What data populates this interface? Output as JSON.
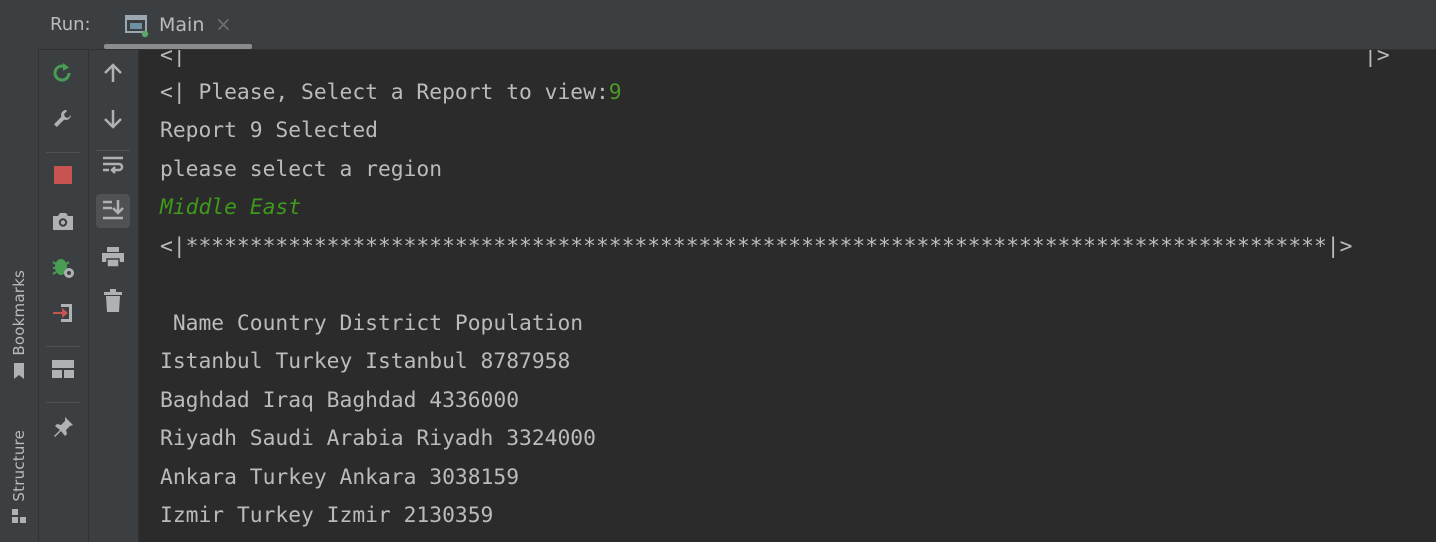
{
  "left_strip": {
    "bookmarks_label": "Bookmarks",
    "structure_label": "Structure"
  },
  "header": {
    "run_label": "Run:",
    "tab_label": "Main",
    "tab_close": "×"
  },
  "console": {
    "line0_left": "<|",
    "line0_right": "|>",
    "prompt_text": "<| Please, Select a Report to view:",
    "prompt_input": "9",
    "report_selected": "Report 9 Selected",
    "region_prompt": "please select a region",
    "region_input": "Middle East",
    "separator": "<|*****************************************************************************************|>",
    "table_header": " Name Country District Population",
    "rows": [
      "Istanbul Turkey Istanbul 8787958",
      "Baghdad Iraq Baghdad 4336000",
      "Riyadh Saudi Arabia Riyadh 3324000",
      "Ankara Turkey Ankara 3038159",
      "Izmir Turkey Izmir 2130359"
    ]
  },
  "colors": {
    "user_input": "#4e9a28",
    "text": "#bbbbbb",
    "background": "#2b2b2b",
    "panel": "#3c3f41"
  }
}
